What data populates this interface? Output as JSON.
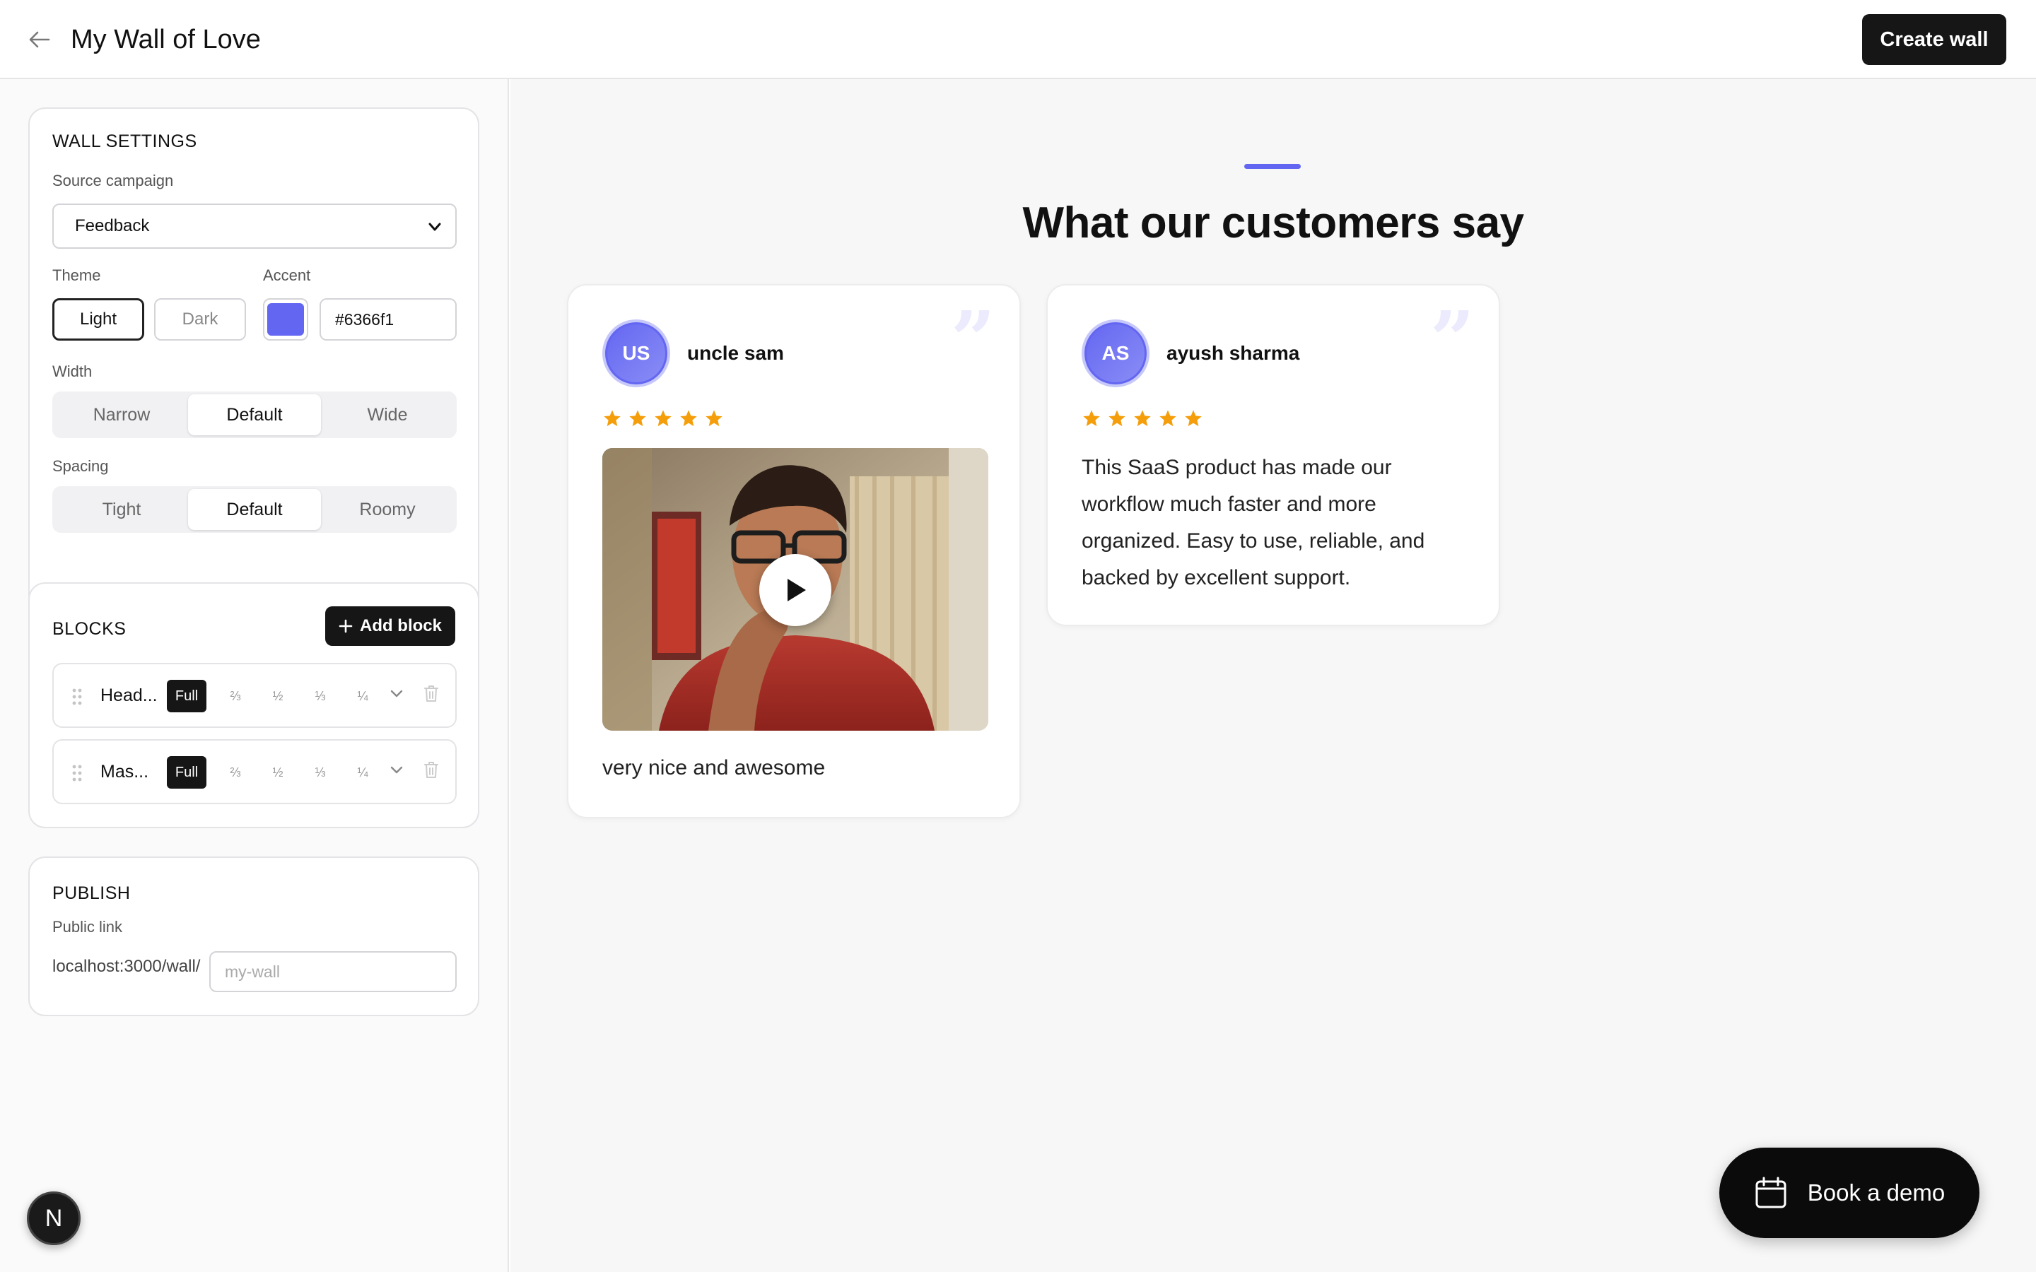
{
  "header": {
    "title": "My Wall of Love",
    "create_label": "Create wall"
  },
  "wall_settings": {
    "title": "WALL SETTINGS",
    "source_label": "Source campaign",
    "source_value": "Feedback",
    "theme_label": "Theme",
    "theme_options": [
      "Light",
      "Dark"
    ],
    "theme_selected": "Light",
    "accent_label": "Accent",
    "accent_color": "#6366f1",
    "accent_hex": "#6366f1",
    "width_label": "Width",
    "width_options": [
      "Narrow",
      "Default",
      "Wide"
    ],
    "width_selected": "Default",
    "spacing_label": "Spacing",
    "spacing_options": [
      "Tight",
      "Default",
      "Roomy"
    ],
    "spacing_selected": "Default"
  },
  "blocks": {
    "title": "BLOCKS",
    "add_label": "Add block",
    "sizes": [
      "Full",
      "⅔",
      "½",
      "⅓",
      "¼"
    ],
    "items": [
      {
        "name": "Head...",
        "size": "Full"
      },
      {
        "name": "Mas...",
        "size": "Full"
      }
    ]
  },
  "publish": {
    "title": "PUBLISH",
    "link_label": "Public link",
    "prefix": "localhost:3000/wall/",
    "placeholder": "my-wall"
  },
  "preview": {
    "headline": "What our customers say",
    "testimonials": [
      {
        "initials": "US",
        "name": "uncle sam",
        "rating": 5,
        "has_video": true,
        "text": "very nice and awesome"
      },
      {
        "initials": "AS",
        "name": "ayush sharma",
        "rating": 5,
        "has_video": false,
        "text": "This SaaS product has made our workflow much faster and more organized. Easy to use, reliable, and backed by excellent support."
      }
    ]
  },
  "floating": {
    "demo_label": "Book a demo",
    "badge_letter": "N"
  },
  "colors": {
    "accent": "#6366f1",
    "star": "#f59e0b",
    "quote": "#ecebfd",
    "dark_button": "#161616"
  }
}
